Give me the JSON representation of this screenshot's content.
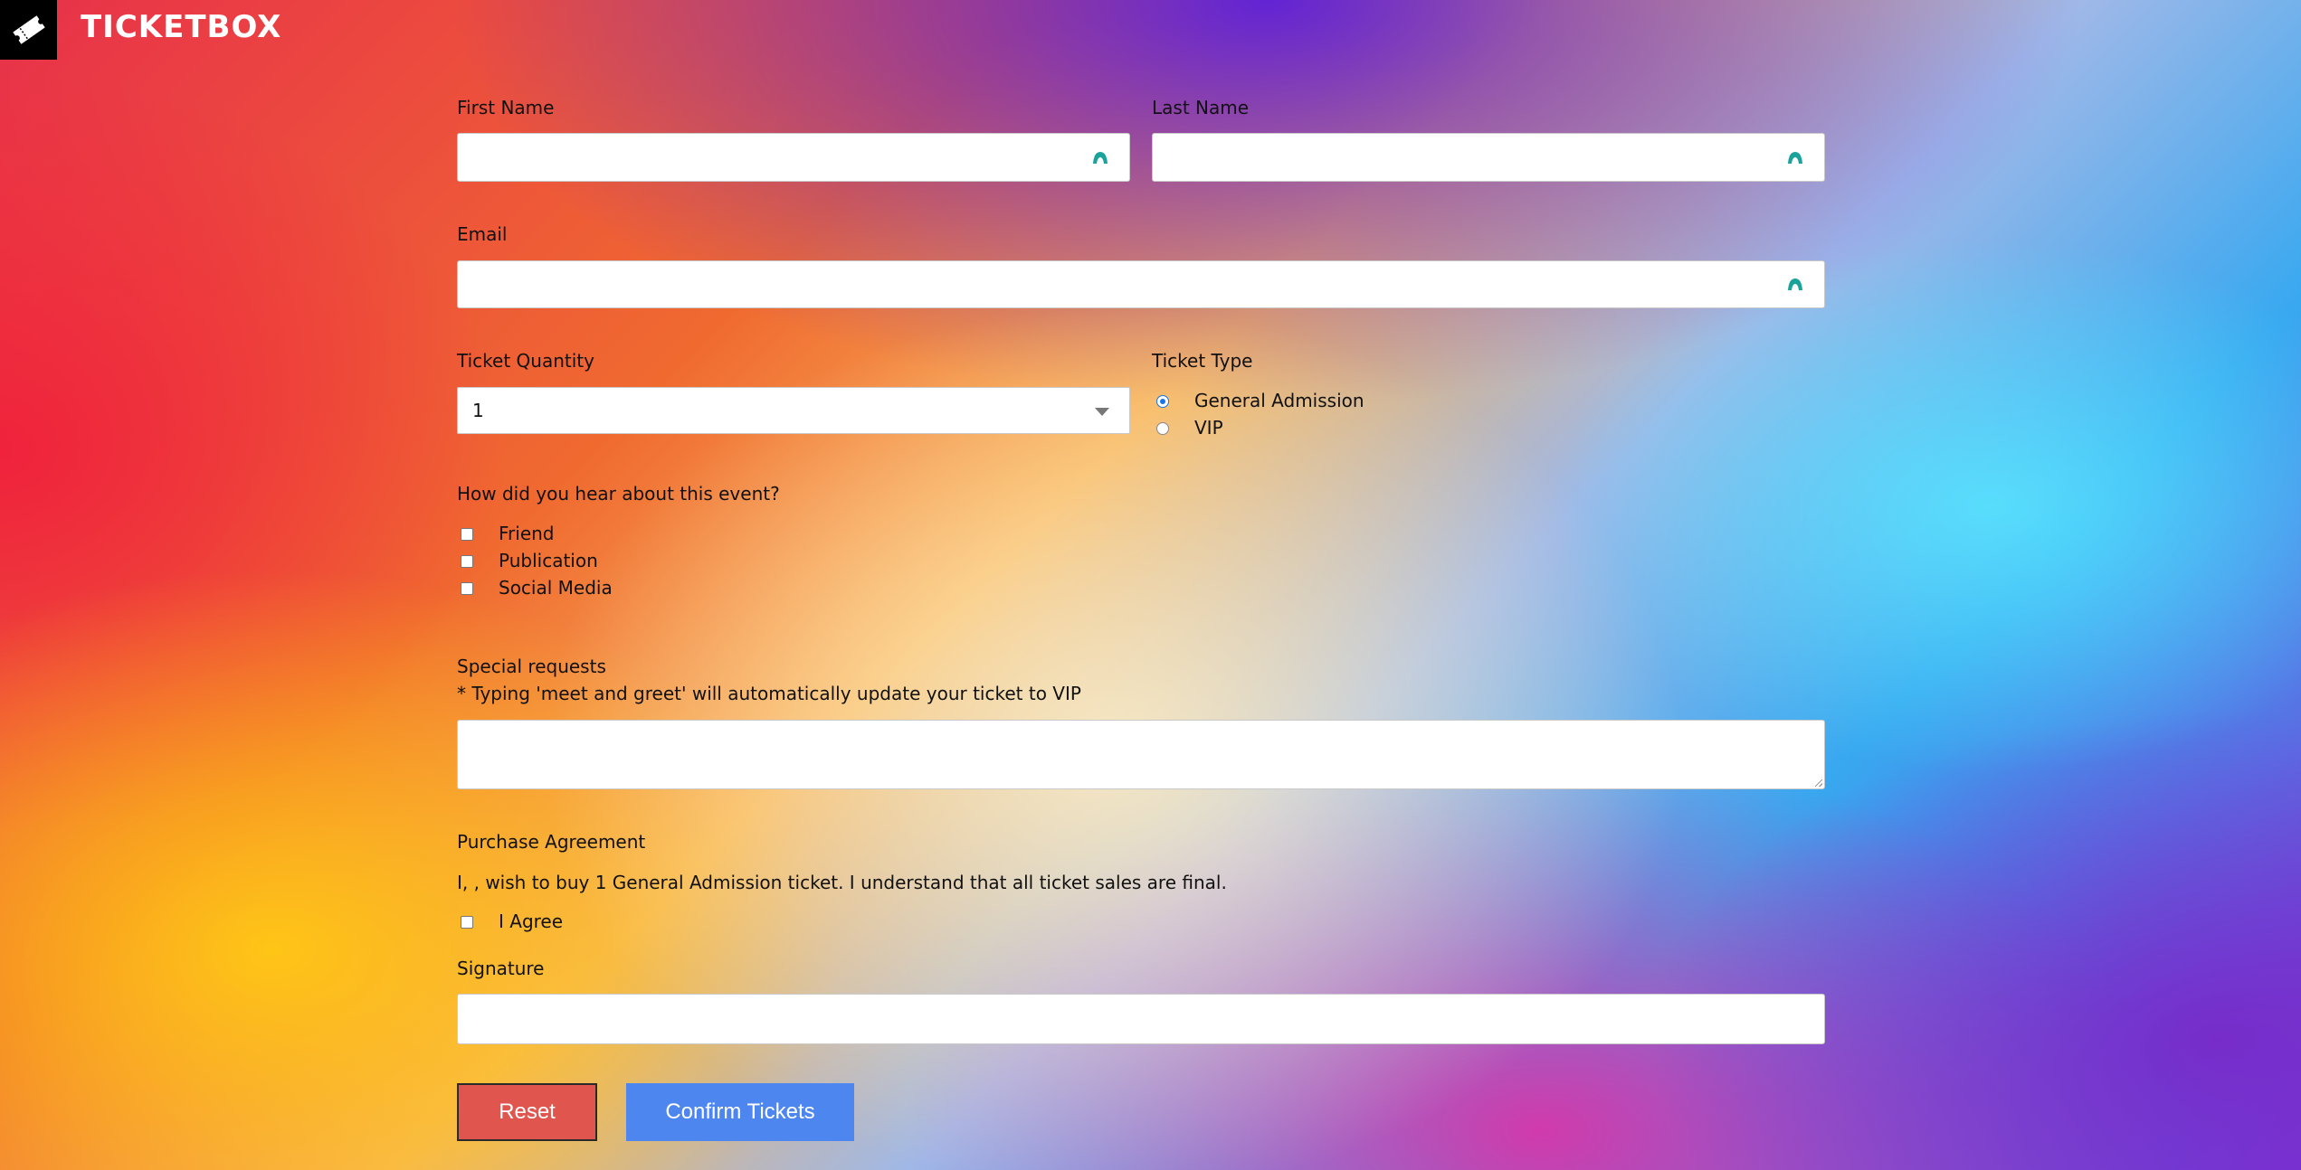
{
  "app": {
    "title": "TICKETBOX",
    "logo_icon": "ticket-icon"
  },
  "form": {
    "first_name": {
      "label": "First Name",
      "value": "",
      "icon": "autofill-icon"
    },
    "last_name": {
      "label": "Last Name",
      "value": "",
      "icon": "autofill-icon"
    },
    "email": {
      "label": "Email",
      "value": "",
      "icon": "autofill-icon"
    },
    "ticket_quantity": {
      "label": "Ticket Quantity",
      "selected": "1"
    },
    "ticket_type": {
      "label": "Ticket Type",
      "options": [
        {
          "label": "General Admission",
          "checked": true
        },
        {
          "label": "VIP",
          "checked": false
        }
      ]
    },
    "referral": {
      "label": "How did you hear about this event?",
      "options": [
        {
          "label": "Friend",
          "checked": false
        },
        {
          "label": "Publication",
          "checked": false
        },
        {
          "label": "Social Media",
          "checked": false
        }
      ]
    },
    "special_requests": {
      "label": "Special requests",
      "note": "* Typing 'meet and greet' will automatically update your ticket to VIP",
      "value": ""
    },
    "purchase_agreement": {
      "label": "Purchase Agreement",
      "text": "I, , wish to buy 1 General Admission ticket. I understand that all ticket sales are final.",
      "agree_label": "I Agree",
      "agree_checked": false
    },
    "signature": {
      "label": "Signature",
      "value": ""
    },
    "buttons": {
      "reset": "Reset",
      "confirm": "Confirm Tickets"
    }
  },
  "colors": {
    "reset_button": "#e0564e",
    "confirm_button": "#4d86ef",
    "radio_accent": "#1a73e8",
    "autofill_icon": "#1aa39a"
  }
}
